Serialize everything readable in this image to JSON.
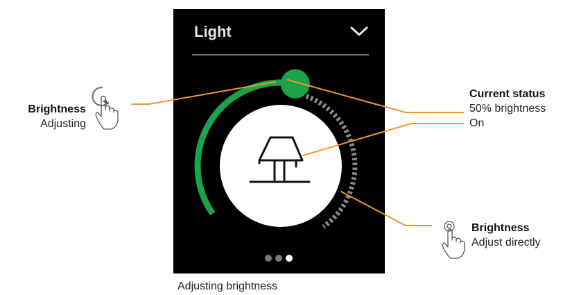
{
  "widget": {
    "title": "Light",
    "brightness_percent": 50,
    "page_count": 3,
    "active_page": 3
  },
  "caption": "Adjusting brightness",
  "callouts": {
    "adjusting": {
      "heading": "Brightness",
      "text": "Adjusting"
    },
    "status": {
      "heading": "Current status",
      "line1": "50% brightness",
      "line2": "On"
    },
    "direct": {
      "heading": "Brightness",
      "text": "Adjust directly"
    }
  },
  "icons": {
    "dropdown": "chevron-down-icon",
    "lamp": "lamp-icon",
    "rotate_gesture": "rotate-gesture-icon",
    "tap_gesture": "tap-gesture-icon"
  },
  "colors": {
    "accent_green": "#1aa34a",
    "leader_orange": "#f0982a",
    "device_bg": "#000000",
    "track_dashes": "#8c8c8c"
  }
}
